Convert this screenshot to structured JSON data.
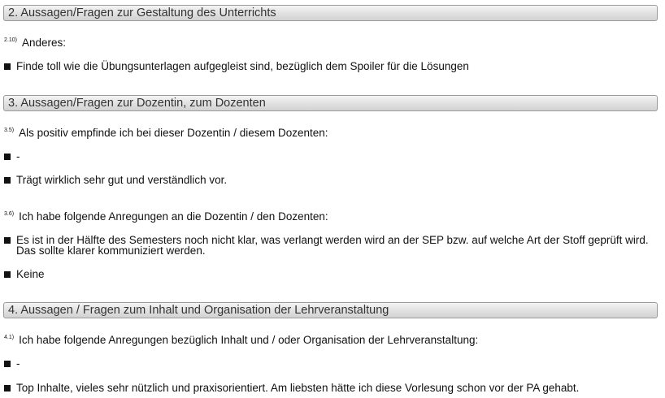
{
  "sections": [
    {
      "title": "2. Aussagen/Fragen zur Gestaltung des Unterrichts",
      "questions": [
        {
          "number": "2.10)",
          "text": "Anderes:",
          "answers": [
            "Finde toll wie die Übungsunterlagen aufgegleist sind, bezüglich dem Spoiler für die Lösungen"
          ]
        }
      ]
    },
    {
      "title": "3. Aussagen/Fragen zur Dozentin, zum Dozenten",
      "questions": [
        {
          "number": "3.5)",
          "text": "Als positiv empfinde ich bei dieser Dozentin / diesem Dozenten:",
          "answers": [
            "-",
            "Trägt wirklich sehr gut und verständlich vor."
          ]
        },
        {
          "number": "3.6)",
          "text": "Ich habe folgende Anregungen an die Dozentin / den Dozenten:",
          "answers": [
            "Es ist in der Hälfte des Semesters noch nicht klar, was verlangt werden wird an der SEP bzw. auf welche Art der Stoff geprüft wird. Das sollte klarer kommuniziert werden.",
            "Keine"
          ]
        }
      ]
    },
    {
      "title": "4. Aussagen / Fragen zum Inhalt und Organisation der Lehrveranstaltung",
      "questions": [
        {
          "number": "4.1)",
          "text": "Ich habe folgende Anregungen bezüglich Inhalt und / oder Organisation der Lehrveranstaltung:",
          "answers": [
            "-",
            "Top Inhalte, vieles sehr nützlich und praxisorientiert. Am liebsten hätte ich diese Vorlesung schon vor der PA gehabt."
          ]
        }
      ]
    }
  ]
}
